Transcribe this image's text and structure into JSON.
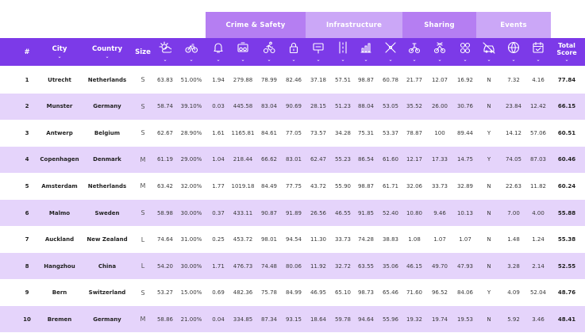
{
  "groups": {
    "crime": "Crime & Safety",
    "infra": "Infrastructure",
    "sharing": "Sharing",
    "events": "Events"
  },
  "headers": {
    "rank": "#",
    "city": "City",
    "country": "Country",
    "size": "Size",
    "total_line1": "Total",
    "total_line2": "Score",
    "chevron": "⌄"
  },
  "icons": [
    "weather-icon",
    "bicycle-icon",
    "bell-icon",
    "bike-theft-icon",
    "cyclist-icon",
    "lock-icon",
    "road-sign-icon",
    "bike-lane-icon",
    "chart-icon",
    "route-icon",
    "bike-share-icon",
    "share-station-icon",
    "bike-group-icon",
    "car-free-icon",
    "globe-icon",
    "calendar-icon"
  ],
  "colors": {
    "header": "#7c3ae8",
    "group_dark": "#b57ef2",
    "group_light": "#cba7f7",
    "row_alt": "#e5d4fb"
  },
  "rows": [
    {
      "rank": "1",
      "city": "Utrecht",
      "country": "Netherlands",
      "size": "S",
      "v": [
        "63.83",
        "51.00%",
        "1.94",
        "279.88",
        "78.99",
        "82.46",
        "37.18",
        "57.51",
        "98.87",
        "60.78",
        "21.77",
        "12.07",
        "16.92",
        "N",
        "7.32",
        "4.16"
      ],
      "total": "77.84"
    },
    {
      "rank": "2",
      "city": "Munster",
      "country": "Germany",
      "size": "S",
      "v": [
        "58.74",
        "39.10%",
        "0.03",
        "445.58",
        "83.04",
        "90.69",
        "28.15",
        "51.23",
        "88.04",
        "53.05",
        "35.52",
        "26.00",
        "30.76",
        "N",
        "23.84",
        "12.42"
      ],
      "total": "66.15"
    },
    {
      "rank": "3",
      "city": "Antwerp",
      "country": "Belgium",
      "size": "S",
      "v": [
        "62.67",
        "28.90%",
        "1.61",
        "1165.81",
        "84.61",
        "77.05",
        "73.57",
        "34.28",
        "75.31",
        "53.37",
        "78.87",
        "100",
        "89.44",
        "Y",
        "14.12",
        "57.06"
      ],
      "total": "60.51"
    },
    {
      "rank": "4",
      "city": "Copenhagen",
      "country": "Denmark",
      "size": "M",
      "v": [
        "61.19",
        "29.00%",
        "1.04",
        "218.44",
        "66.62",
        "83.01",
        "62.47",
        "55.23",
        "86.54",
        "61.60",
        "12.17",
        "17.33",
        "14.75",
        "Y",
        "74.05",
        "87.03"
      ],
      "total": "60.46"
    },
    {
      "rank": "5",
      "city": "Amsterdam",
      "country": "Netherlands",
      "size": "M",
      "v": [
        "63.42",
        "32.00%",
        "1.77",
        "1019.18",
        "84.49",
        "77.75",
        "43.72",
        "55.90",
        "98.87",
        "61.71",
        "32.06",
        "33.73",
        "32.89",
        "N",
        "22.63",
        "11.82"
      ],
      "total": "60.24"
    },
    {
      "rank": "6",
      "city": "Malmo",
      "country": "Sweden",
      "size": "S",
      "v": [
        "58.98",
        "30.00%",
        "0.37",
        "433.11",
        "90.87",
        "91.89",
        "26.56",
        "46.55",
        "91.85",
        "52.40",
        "10.80",
        "9.46",
        "10.13",
        "N",
        "7.00",
        "4.00"
      ],
      "total": "55.88"
    },
    {
      "rank": "7",
      "city": "Auckland",
      "country": "New Zealand",
      "size": "L",
      "v": [
        "74.64",
        "31.00%",
        "0.25",
        "453.72",
        "98.01",
        "94.54",
        "11.30",
        "33.73",
        "74.28",
        "38.83",
        "1.08",
        "1.07",
        "1.07",
        "N",
        "1.48",
        "1.24"
      ],
      "total": "55.38"
    },
    {
      "rank": "8",
      "city": "Hangzhou",
      "country": "China",
      "size": "L",
      "v": [
        "54.20",
        "30.00%",
        "1.71",
        "476.73",
        "74.48",
        "80.06",
        "11.92",
        "32.72",
        "63.55",
        "35.06",
        "46.15",
        "49.70",
        "47.93",
        "N",
        "3.28",
        "2.14"
      ],
      "total": "52.55"
    },
    {
      "rank": "9",
      "city": "Bern",
      "country": "Switzerland",
      "size": "S",
      "v": [
        "53.27",
        "15.00%",
        "0.69",
        "482.36",
        "75.78",
        "84.99",
        "46.95",
        "65.10",
        "98.73",
        "65.46",
        "71.60",
        "96.52",
        "84.06",
        "Y",
        "4.09",
        "52.04"
      ],
      "total": "48.76"
    },
    {
      "rank": "10",
      "city": "Bremen",
      "country": "Germany",
      "size": "M",
      "v": [
        "58.86",
        "21.00%",
        "0.04",
        "334.85",
        "87.34",
        "93.15",
        "18.64",
        "59.78",
        "94.64",
        "55.96",
        "19.32",
        "19.74",
        "19.53",
        "N",
        "5.92",
        "3.46"
      ],
      "total": "48.41"
    }
  ]
}
